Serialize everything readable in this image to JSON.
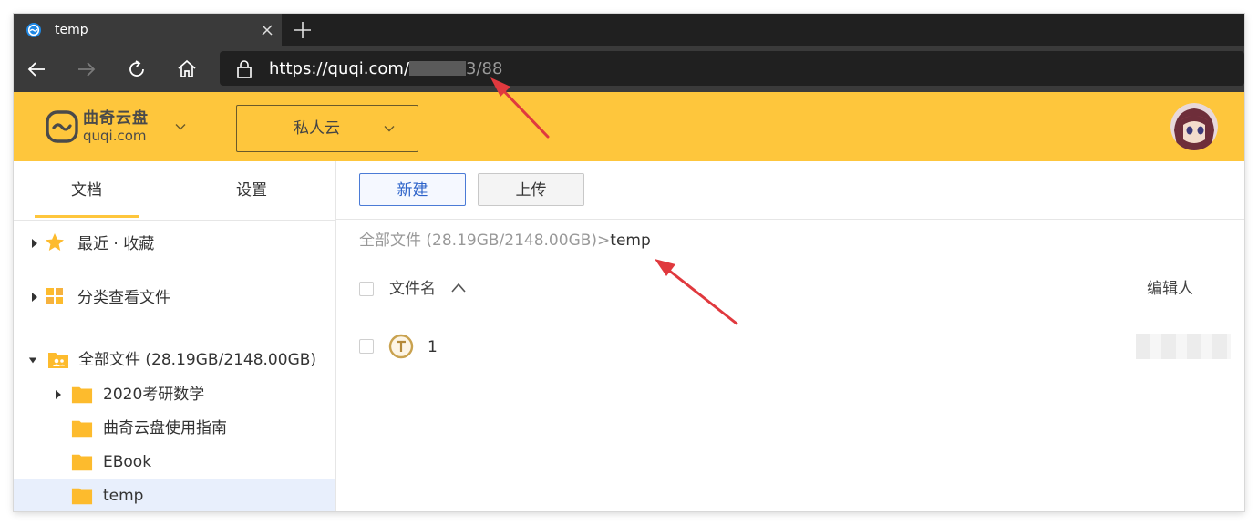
{
  "browser": {
    "tab_title": "temp",
    "url_main": "https://quqi.com/",
    "url_tail": "3/88"
  },
  "header": {
    "logo_cn": "曲奇云盘",
    "logo_en": "quqi.com",
    "space_selector": "私人云"
  },
  "sidebar": {
    "tabs": [
      "文档",
      "设置"
    ],
    "items": [
      {
        "label": "最近 · 收藏",
        "icon": "star-icon"
      },
      {
        "label": "分类查看文件",
        "icon": "category-icon"
      },
      {
        "label": "全部文件 (28.19GB/2148.00GB)",
        "icon": "shared-folder-icon"
      },
      {
        "label": "2020考研数学",
        "icon": "folder-icon"
      },
      {
        "label": "曲奇云盘使用指南",
        "icon": "folder-icon"
      },
      {
        "label": "EBook",
        "icon": "folder-icon"
      },
      {
        "label": "temp",
        "icon": "folder-icon"
      }
    ]
  },
  "main": {
    "new_button": "新建",
    "upload_button": "上传",
    "breadcrumb_root": "全部文件 (28.19GB/2148.00GB)",
    "breadcrumb_sep": ">",
    "breadcrumb_current": "temp",
    "columns": {
      "name": "文件名",
      "editor": "编辑人"
    },
    "files": [
      {
        "name": "1",
        "icon": "text-file-icon"
      }
    ]
  },
  "colors": {
    "brand_yellow": "#fec63c",
    "annotation_red": "#e0393e",
    "primary_blue": "#2c62c9"
  }
}
